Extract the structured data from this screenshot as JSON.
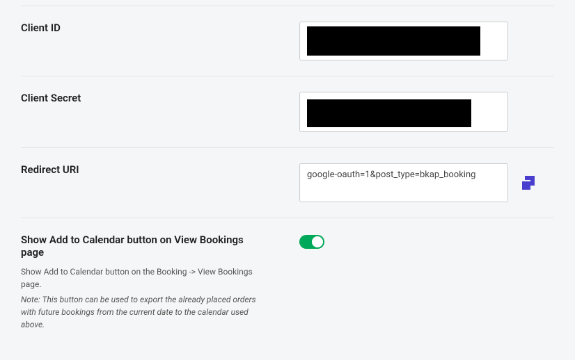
{
  "fields": {
    "client_id": {
      "label": "Client ID",
      "value": "[REDACTED]"
    },
    "client_secret": {
      "label": "Client Secret",
      "value": "[REDACTED]"
    },
    "redirect_uri": {
      "label": "Redirect URI",
      "value": "google-oauth=1&post_type=bkap_booking"
    },
    "show_add_calendar": {
      "label": "Show Add to Calendar button on View Bookings page",
      "sub": "Show Add to Calendar button on the Booking -> View Bookings page.",
      "note": "Note: This button can be used to export the already placed orders with future bookings from the current date to the calendar used above.",
      "enabled": true
    }
  }
}
